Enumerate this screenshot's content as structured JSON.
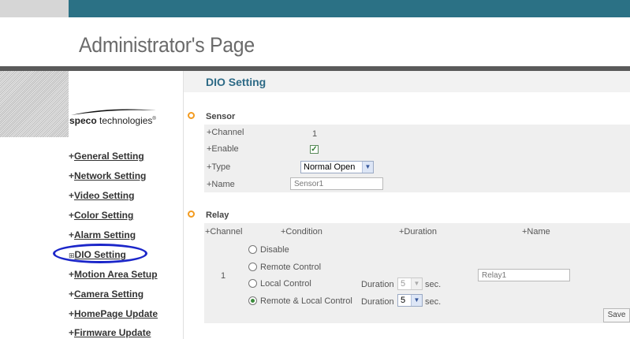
{
  "header": {
    "title": "Administrator's Page"
  },
  "logo": {
    "brand": "speco",
    "suffix": "technologies",
    "mark": "®"
  },
  "sidebar": {
    "items": [
      {
        "label": "General Setting"
      },
      {
        "label": "Network Setting"
      },
      {
        "label": "Video Setting"
      },
      {
        "label": "Color Setting"
      },
      {
        "label": "Alarm Setting"
      },
      {
        "label": "DIO Setting"
      },
      {
        "label": "Motion Area Setup"
      },
      {
        "label": "Camera Setting"
      },
      {
        "label": "HomePage Update"
      },
      {
        "label": "Firmware Update"
      }
    ],
    "plus": "+",
    "active_marker": "⊞"
  },
  "main": {
    "heading": "DIO Setting",
    "sensor": {
      "title": "Sensor",
      "channel_label": "+Channel",
      "channel_value": "1",
      "enable_label": "+Enable",
      "enable_checked": true,
      "type_label": "+Type",
      "type_value": "Normal Open",
      "name_label": "+Name",
      "name_value": "Sensor1"
    },
    "relay": {
      "title": "Relay",
      "col_channel": "+Channel",
      "col_condition": "+Condition",
      "col_duration": "+Duration",
      "col_name": "+Name",
      "channel_value": "1",
      "options": [
        "Disable",
        "Remote Control",
        "Local Control",
        "Remote & Local Control"
      ],
      "selected_option": "Remote & Local Control",
      "duration_label": "Duration",
      "local_duration_value": "5",
      "remote_local_duration_value": "5",
      "sec_label": "sec.",
      "name_value": "Relay1"
    },
    "save_label": "Save"
  },
  "colors": {
    "header_teal": "#2b7185",
    "accent_orange": "#f39b1f",
    "heading_blue": "#2d6a86",
    "highlight_ellipse": "#1b26c9"
  }
}
